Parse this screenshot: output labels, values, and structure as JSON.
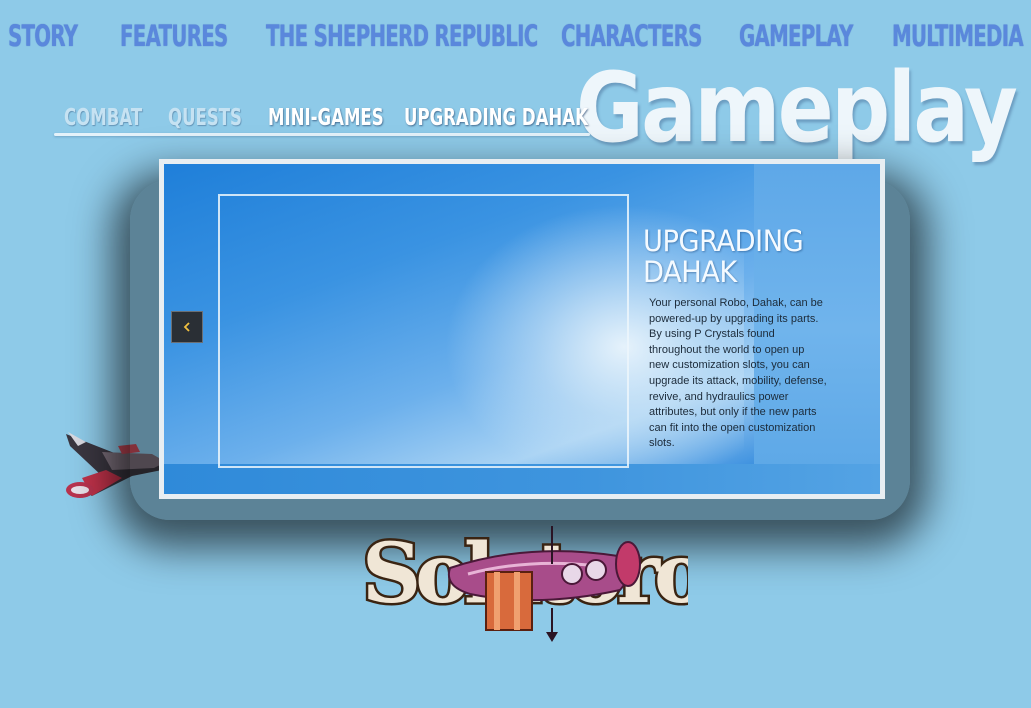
{
  "top_nav": {
    "items": [
      "Story",
      "Features",
      "The Shepherd Republic",
      "Characters",
      "Gameplay",
      "Multimedia"
    ]
  },
  "section_title": "Gameplay",
  "sub_nav": {
    "items": [
      "Combat",
      "Quests",
      "Mini-Games",
      "Upgrading  Dahak"
    ]
  },
  "slide": {
    "title": "Upgrading Dahak",
    "body": "Your personal Robo, Dahak, can be powered-up by upgrading its parts. By using P Crystals found throughout the world to open up new customization slots, you can upgrade its attack, mobility, defense, revive, and hydraulics power attributes, but only if the new parts can fit into the open customization slots.",
    "prev_icon": "chevron-left-icon"
  },
  "logo": {
    "text": "Solatorobo"
  },
  "colors": {
    "background": "#8ecae8",
    "nav_text": "#5a88dc",
    "slider_blue": "#2b86dc",
    "prev_chevron": "#f0c040"
  }
}
